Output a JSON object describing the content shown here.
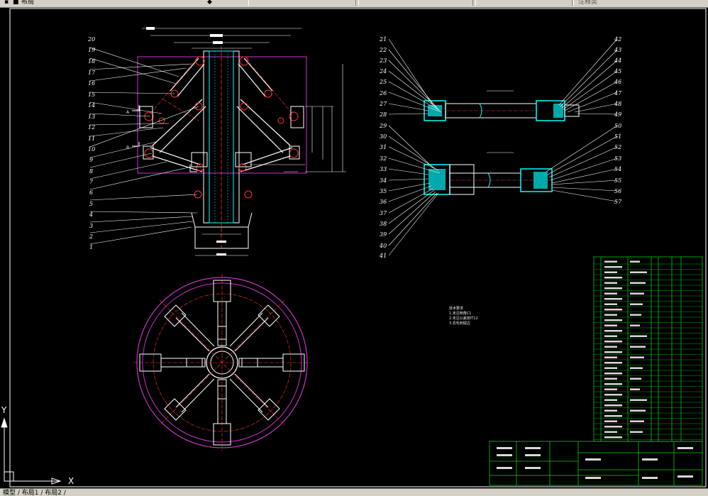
{
  "toolbar": {
    "title_fragment": "布局",
    "tab_labels": [
      "",
      "",
      "",
      ""
    ],
    "search_placeholder": "注释类"
  },
  "ucs": {
    "x_label": "X",
    "y_label": "Y"
  },
  "callouts_left": [
    "20",
    "19",
    "18",
    "17",
    "16",
    "15",
    "14",
    "13",
    "12",
    "11",
    "10",
    "9",
    "8",
    "7",
    "6",
    "5",
    "4",
    "3",
    "2",
    "1"
  ],
  "callouts_right_left": [
    "21",
    "22",
    "23",
    "24",
    "25",
    "26",
    "27",
    "28",
    "29",
    "30",
    "31",
    "32",
    "33",
    "34",
    "35",
    "36",
    "37",
    "38",
    "39",
    "40",
    "41"
  ],
  "callouts_right_right": [
    "42",
    "43",
    "44",
    "45",
    "46",
    "47",
    "48",
    "49",
    "50",
    "51",
    "52",
    "53",
    "54",
    "55",
    "56",
    "57"
  ],
  "view_marks": {
    "a": "A",
    "b": "B"
  },
  "notes": {
    "heading": "技术要求",
    "lines": [
      "1.未注倒角C1",
      "2.未注公差按IT12",
      "3.去毛刺锐边"
    ]
  },
  "status": {
    "layout_tabs": "模型 / 布局1 / 布局2 /"
  },
  "colors": {
    "background": "#000000",
    "outline": "#ffffff",
    "center": "#ff3333",
    "frame": "#cc33cc",
    "cyan": "#00ffff",
    "table": "#00cc00",
    "dims": "#ffffff"
  }
}
